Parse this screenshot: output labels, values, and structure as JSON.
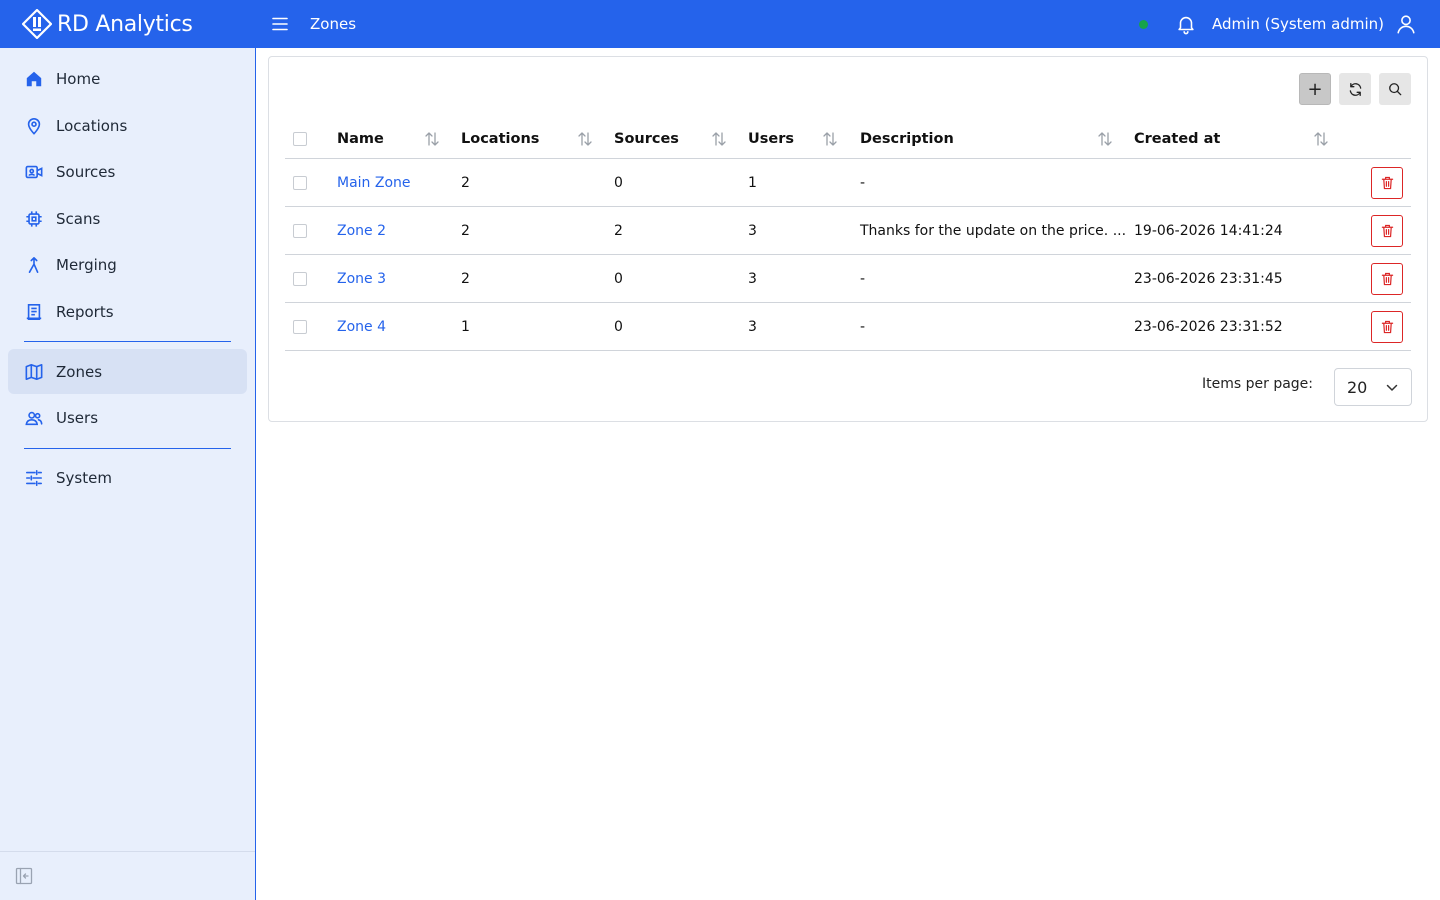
{
  "app": {
    "name": "RD Analytics",
    "page_title": "Zones",
    "user_label": "Admin (System admin)",
    "status_color": "#16a34a",
    "accent_color": "#2563eb"
  },
  "sidebar": {
    "items": [
      {
        "label": "Home",
        "icon": "home-icon"
      },
      {
        "label": "Locations",
        "icon": "map-pin-icon"
      },
      {
        "label": "Sources",
        "icon": "camera-icon"
      },
      {
        "label": "Scans",
        "icon": "chip-icon"
      },
      {
        "label": "Merging",
        "icon": "merge-icon"
      },
      {
        "label": "Reports",
        "icon": "report-icon"
      },
      {
        "label": "Zones",
        "icon": "map-icon",
        "active": true
      },
      {
        "label": "Users",
        "icon": "users-icon"
      },
      {
        "label": "System",
        "icon": "sliders-icon"
      }
    ]
  },
  "toolbar": {
    "add_label": "+",
    "refresh_icon": "refresh-icon",
    "search_icon": "search-icon"
  },
  "table": {
    "columns": [
      "Name",
      "Locations",
      "Sources",
      "Users",
      "Description",
      "Created at"
    ],
    "rows": [
      {
        "name": "Main Zone",
        "locations": "2",
        "sources": "0",
        "users": "1",
        "description": "-",
        "created_at": ""
      },
      {
        "name": "Zone 2",
        "locations": "2",
        "sources": "2",
        "users": "3",
        "description": "Thanks for the update on the price. ...",
        "created_at": "19-06-2026 14:41:24"
      },
      {
        "name": "Zone 3",
        "locations": "2",
        "sources": "0",
        "users": "3",
        "description": "-",
        "created_at": "23-06-2026 23:31:45"
      },
      {
        "name": "Zone 4",
        "locations": "1",
        "sources": "0",
        "users": "3",
        "description": "-",
        "created_at": "23-06-2026 23:31:52"
      }
    ]
  },
  "pager": {
    "label": "Items per page:",
    "value": "20"
  }
}
